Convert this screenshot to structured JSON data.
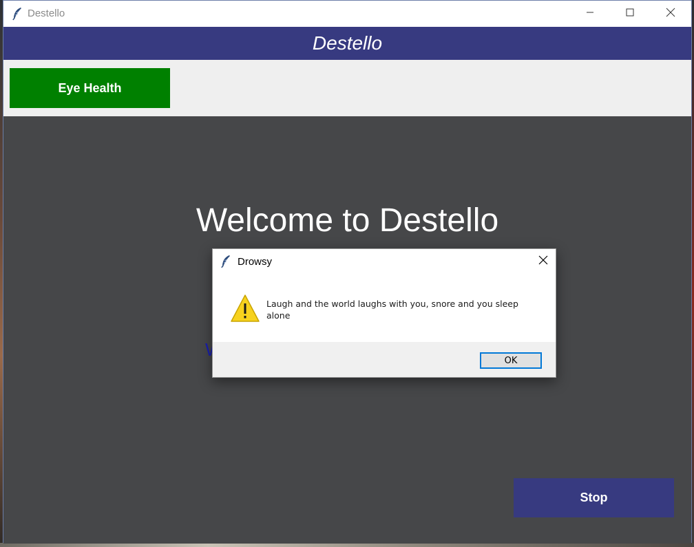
{
  "window": {
    "title": "Destello",
    "controls": {
      "minimize": "minimize-icon",
      "maximize": "maximize-icon",
      "close": "close-icon"
    }
  },
  "banner": {
    "title": "Destello",
    "background": "#373a80"
  },
  "toolbar": {
    "eye_health_label": "Eye Health",
    "eye_health_color": "#008000"
  },
  "main": {
    "welcome_text": "Welcome to Destello",
    "partial_label": "W",
    "stop_label": "Stop",
    "stop_color": "#373a80"
  },
  "dialog": {
    "title": "Drowsy",
    "icon": "warning-icon",
    "message": "Laugh and the world laughs with you, snore and you sleep alone",
    "ok_label": "OK"
  }
}
